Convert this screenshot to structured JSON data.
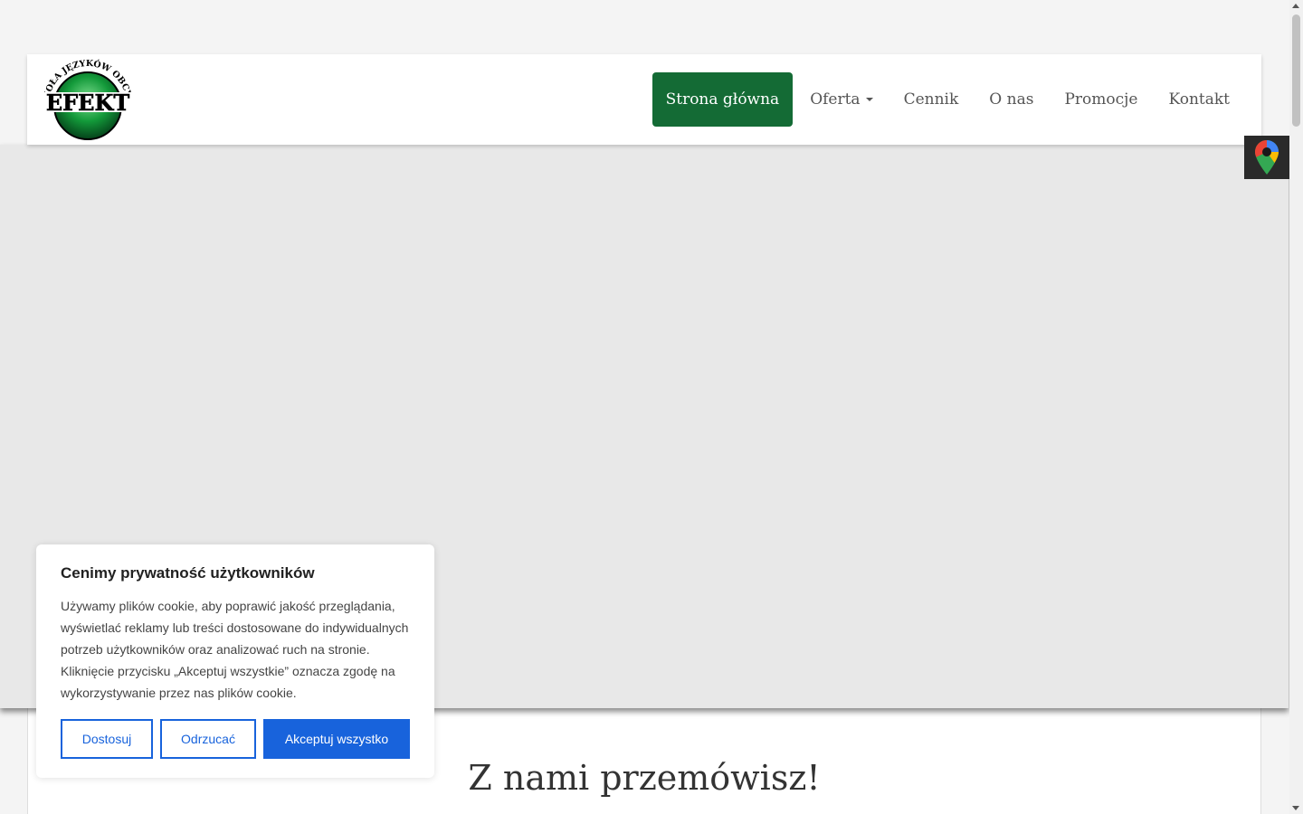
{
  "header": {
    "logo": {
      "arc_text": "SZKOŁA JĘZYKÓW OBCYCH",
      "brand_text": "EFEKT"
    },
    "nav": [
      {
        "label": "Strona główna",
        "active": true
      },
      {
        "label": "Oferta",
        "dropdown": true
      },
      {
        "label": "Cennik"
      },
      {
        "label": "O nas"
      },
      {
        "label": "Promocje"
      },
      {
        "label": "Kontakt"
      }
    ]
  },
  "main": {
    "heading": "Z nami przemówisz!"
  },
  "floating": {
    "maps_icon": "google-maps-pin-icon"
  },
  "cookie_banner": {
    "title": "Cenimy prywatność użytkowników",
    "text": "Używamy plików cookie, aby poprawić jakość przeglądania, wyświetlać reklamy lub treści dostosowane do indywidualnych potrzeb użytkowników oraz analizować ruch na stronie. Kliknięcie przycisku „Akceptuj wszystkie” oznacza zgodę na wykorzystywanie przez nas plików cookie.",
    "buttons": {
      "customize": "Dostosuj",
      "reject": "Odrzucać",
      "accept": "Akceptuj wszystko"
    }
  },
  "colors": {
    "brand_green": "#146b35",
    "accent_blue": "#1863dc",
    "hero_placeholder": "#e8e8e8"
  }
}
